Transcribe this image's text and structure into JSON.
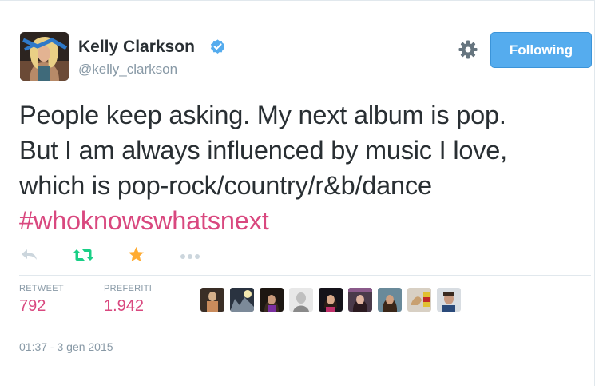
{
  "author": {
    "name": "Kelly Clarkson",
    "handle": "@kelly_clarkson"
  },
  "header": {
    "follow_label": "Following"
  },
  "tweet": {
    "lines": [
      "People keep asking. My next album is pop.",
      "But I am always influenced by music I love,",
      "which is pop-rock/country/r&b/dance"
    ],
    "hashtag": "#whoknowswhatsnext"
  },
  "actions": {
    "icons": [
      "reply-icon",
      "retweet-icon",
      "favorite-icon",
      "more-icon"
    ]
  },
  "stats": {
    "retweets_label": "RETWEET",
    "retweets_value": "792",
    "favorites_label": "PREFERITI",
    "favorites_value": "1.942"
  },
  "favorited_by": {
    "count_shown": 9
  },
  "meta": {
    "timestamp": "01:37 - 3 gen 2015"
  },
  "colors": {
    "accent_pink": "#d9487f",
    "follow_blue": "#55acee",
    "retweet_green": "#19cf86",
    "favorite_gold": "#ffac33",
    "muted_gray": "#8899a6"
  }
}
